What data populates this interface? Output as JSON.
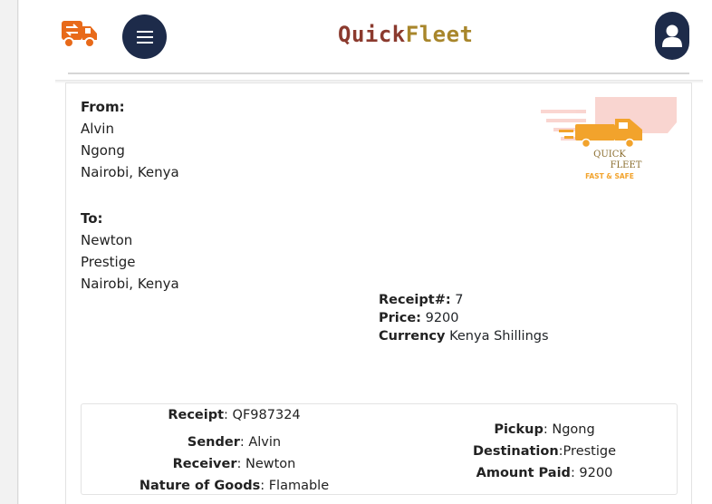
{
  "app": {
    "brand_part1": "Quick",
    "brand_part2": "Fleet"
  },
  "colors": {
    "nav_button_bg": "#1d2b4a",
    "brand_part1": "#8b3a2e",
    "brand_part2": "#a8862b",
    "logo_orange": "#e86a1a"
  },
  "icons": {
    "logo": "delivery-truck-icon",
    "menu": "hamburger-menu-icon",
    "user": "user-icon"
  },
  "watermark": {
    "line1": "QUICK",
    "line2": "FLEET",
    "tagline": "FAST & SAFE"
  },
  "receipt": {
    "from": {
      "label": "From:",
      "name": "Alvin",
      "area": "Ngong",
      "city": "Nairobi, Kenya"
    },
    "to": {
      "label": "To:",
      "name": "Newton",
      "area": "Prestige",
      "city": "Nairobi, Kenya"
    },
    "meta": {
      "receipt_no_label": "Receipt#:",
      "receipt_no": "7",
      "price_label": "Price:",
      "price": "9200",
      "currency_label": "Currency",
      "currency": "Kenya Shillings"
    },
    "summary": {
      "receipt_label": "Receipt",
      "receipt_code": ": QF987324",
      "sender_label": "Sender",
      "sender": ": Alvin",
      "receiver_label": "Receiver",
      "receiver": ": Newton",
      "goods_label": "Nature of Goods",
      "goods": ": Flamable",
      "pickup_label": "Pickup",
      "pickup": ": Ngong",
      "destination_label": "Destination",
      "destination": ":Prestige",
      "amount_label": "Amount Paid",
      "amount": ": 9200"
    }
  }
}
